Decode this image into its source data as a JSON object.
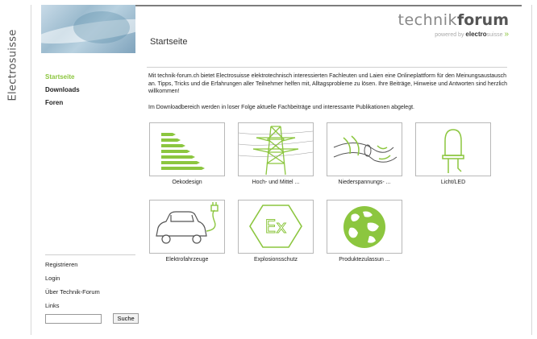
{
  "side_label": "Electrosuisse",
  "logo": {
    "word1": "technik",
    "word2": "forum",
    "tagline": "powered by",
    "brand": "electro",
    "brand_suffix": "suisse",
    "arrow": "»"
  },
  "page_title": "Startseite",
  "nav": [
    {
      "label": "Startseite",
      "active": true
    },
    {
      "label": "Downloads",
      "active": false
    },
    {
      "label": "Foren",
      "active": false
    }
  ],
  "intro": [
    "Mit technik-forum.ch bietet Electrosuisse elektrotechnisch interessierten Fachleuten und Laien eine Onlineplattform für den Meinungsaustausch an. Tipps, Tricks und die Erfahrungen aller Teilnehmer helfen mit, Alltagsprobleme zu lösen. Ihre Beiträge, Hinweise und Antworten sind herzlich willkommen!",
    "Im Downloadbereich werden in loser Folge aktuelle Fachbeiträge und interessante Publikationen abgelegt."
  ],
  "tiles": [
    {
      "label": "Oekodesign",
      "icon": "energy-label-icon"
    },
    {
      "label": "Hoch- und Mittel ...",
      "icon": "power-pylon-icon"
    },
    {
      "label": "Niederspannungs- ...",
      "icon": "cable-icon"
    },
    {
      "label": "Licht/LED",
      "icon": "led-icon"
    },
    {
      "label": "Elektrofahrzeuge",
      "icon": "electric-car-icon"
    },
    {
      "label": "Explosionsschutz",
      "icon": "ex-symbol-icon"
    },
    {
      "label": "Produktezulassun ...",
      "icon": "globe-icon"
    }
  ],
  "side_links": [
    "Registrieren",
    "Login",
    "Über Technik-Forum",
    "Links"
  ],
  "search": {
    "value": "",
    "button_label": "Suche"
  },
  "colors": {
    "accent": "#8cc63f",
    "text": "#222222",
    "border": "#b8b8b8"
  }
}
